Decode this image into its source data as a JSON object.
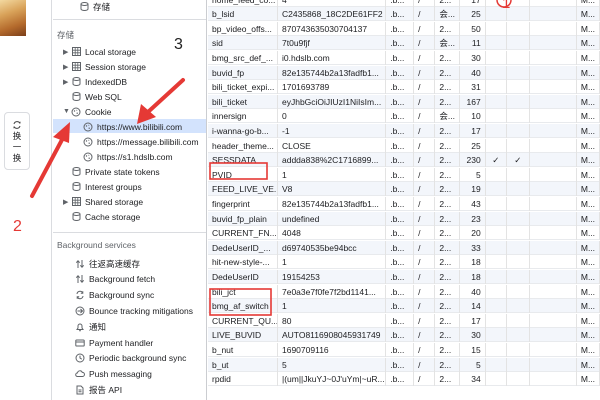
{
  "left_strip": {
    "swap_label_1": "换",
    "swap_label_2": "一",
    "swap_label_3": "换"
  },
  "sidebar": {
    "top_label": "存储",
    "storage_title": "存储",
    "storage_items": [
      {
        "label": "Local storage",
        "icon": "grid-icon"
      },
      {
        "label": "Session storage",
        "icon": "grid-icon"
      },
      {
        "label": "IndexedDB",
        "icon": "database-icon"
      },
      {
        "label": "Web SQL",
        "icon": "database-icon"
      },
      {
        "label": "Cookie",
        "icon": "cookie-icon"
      }
    ],
    "cookie_sites": [
      "https://www.bilibili.com",
      "https://message.bilibili.com",
      "https://s1.hdslb.com"
    ],
    "more_items": [
      {
        "label": "Private state tokens",
        "icon": "database-icon"
      },
      {
        "label": "Interest groups",
        "icon": "database-icon"
      },
      {
        "label": "Shared storage",
        "icon": "grid-icon"
      },
      {
        "label": "Cache storage",
        "icon": "database-icon"
      }
    ],
    "background_title": "Background services",
    "background_items": [
      {
        "label": "往返高速缓存",
        "icon": "cache-arrows-icon"
      },
      {
        "label": "Background fetch",
        "icon": "arrows-icon"
      },
      {
        "label": "Background sync",
        "icon": "sync-icon"
      },
      {
        "label": "Bounce tracking mitigations",
        "icon": "bounce-icon"
      },
      {
        "label": "通知",
        "icon": "bell-icon"
      },
      {
        "label": "Payment handler",
        "icon": "card-icon"
      },
      {
        "label": "Periodic background sync",
        "icon": "clock-icon"
      },
      {
        "label": "Push messaging",
        "icon": "cloud-icon"
      },
      {
        "label": "报告 API",
        "icon": "doc-icon"
      }
    ]
  },
  "cookies": [
    {
      "name": "home_feed_co...",
      "value": "4",
      "domain": ".b...",
      "path": "/",
      "expires": "2...",
      "size": "17",
      "http": "",
      "secure": "",
      "samesite": "",
      "priority": "M..."
    },
    {
      "name": "b_lsid",
      "value": "C2435868_18C2DE61FF2",
      "domain": ".b...",
      "path": "/",
      "expires": "会...",
      "size": "25",
      "http": "",
      "secure": "",
      "samesite": "",
      "priority": "M..."
    },
    {
      "name": "bp_video_offs...",
      "value": "870743635030704137",
      "domain": ".b...",
      "path": "/",
      "expires": "2...",
      "size": "50",
      "http": "",
      "secure": "",
      "samesite": "",
      "priority": "M..."
    },
    {
      "name": "sid",
      "value": "7t0u9fjf",
      "domain": ".b...",
      "path": "/",
      "expires": "会...",
      "size": "11",
      "http": "",
      "secure": "",
      "samesite": "",
      "priority": "M..."
    },
    {
      "name": "bmg_src_def_...",
      "value": "i0.hdslb.com",
      "domain": ".b...",
      "path": "/",
      "expires": "2...",
      "size": "30",
      "http": "",
      "secure": "",
      "samesite": "",
      "priority": "M..."
    },
    {
      "name": "buvid_fp",
      "value": "82e135744b2a13fadfb1...",
      "domain": ".b...",
      "path": "/",
      "expires": "2...",
      "size": "40",
      "http": "",
      "secure": "",
      "samesite": "",
      "priority": "M..."
    },
    {
      "name": "bili_ticket_expi...",
      "value": "1701693789",
      "domain": ".b...",
      "path": "/",
      "expires": "2...",
      "size": "31",
      "http": "",
      "secure": "",
      "samesite": "",
      "priority": "M..."
    },
    {
      "name": "bili_ticket",
      "value": "eyJhbGciOiJIUzI1NiIsIm...",
      "domain": ".b...",
      "path": "/",
      "expires": "2...",
      "size": "167",
      "http": "",
      "secure": "",
      "samesite": "",
      "priority": "M..."
    },
    {
      "name": "innersign",
      "value": "0",
      "domain": ".b...",
      "path": "/",
      "expires": "会...",
      "size": "10",
      "http": "",
      "secure": "",
      "samesite": "",
      "priority": "M..."
    },
    {
      "name": "i-wanna-go-b...",
      "value": "-1",
      "domain": ".b...",
      "path": "/",
      "expires": "2...",
      "size": "17",
      "http": "",
      "secure": "",
      "samesite": "",
      "priority": "M..."
    },
    {
      "name": "header_theme...",
      "value": "CLOSE",
      "domain": ".b...",
      "path": "/",
      "expires": "2...",
      "size": "25",
      "http": "",
      "secure": "",
      "samesite": "",
      "priority": "M..."
    },
    {
      "name": "SESSDATA",
      "value": "addda838%2C1716899...",
      "domain": ".b...",
      "path": "/",
      "expires": "2...",
      "size": "230",
      "http": "✓",
      "secure": "✓",
      "samesite": "",
      "priority": "M..."
    },
    {
      "name": "PVID",
      "value": "1",
      "domain": ".b...",
      "path": "/",
      "expires": "2...",
      "size": "5",
      "http": "",
      "secure": "",
      "samesite": "",
      "priority": "M..."
    },
    {
      "name": "FEED_LIVE_VE...",
      "value": "V8",
      "domain": ".b...",
      "path": "/",
      "expires": "2...",
      "size": "19",
      "http": "",
      "secure": "",
      "samesite": "",
      "priority": "M..."
    },
    {
      "name": "fingerprint",
      "value": "82e135744b2a13fadfb1...",
      "domain": ".b...",
      "path": "/",
      "expires": "2...",
      "size": "43",
      "http": "",
      "secure": "",
      "samesite": "",
      "priority": "M..."
    },
    {
      "name": "buvid_fp_plain",
      "value": "undefined",
      "domain": ".b...",
      "path": "/",
      "expires": "2...",
      "size": "23",
      "http": "",
      "secure": "",
      "samesite": "",
      "priority": "M..."
    },
    {
      "name": "CURRENT_FN...",
      "value": "4048",
      "domain": ".b...",
      "path": "/",
      "expires": "2...",
      "size": "20",
      "http": "",
      "secure": "",
      "samesite": "",
      "priority": "M..."
    },
    {
      "name": "DedeUserID_...",
      "value": "d69740535be94bcc",
      "domain": ".b...",
      "path": "/",
      "expires": "2...",
      "size": "33",
      "http": "",
      "secure": "",
      "samesite": "",
      "priority": "M..."
    },
    {
      "name": "hit-new-style-...",
      "value": "1",
      "domain": ".b...",
      "path": "/",
      "expires": "2...",
      "size": "18",
      "http": "",
      "secure": "",
      "samesite": "",
      "priority": "M..."
    },
    {
      "name": "DedeUserID",
      "value": "19154253",
      "domain": ".b...",
      "path": "/",
      "expires": "2...",
      "size": "18",
      "http": "",
      "secure": "",
      "samesite": "",
      "priority": "M..."
    },
    {
      "name": "bili_jct",
      "value": "7e0a3e7f0fe7f2bd1141...",
      "domain": ".b...",
      "path": "/",
      "expires": "2...",
      "size": "40",
      "http": "",
      "secure": "",
      "samesite": "",
      "priority": "M..."
    },
    {
      "name": "bmg_af_switch",
      "value": "1",
      "domain": ".b...",
      "path": "/",
      "expires": "2...",
      "size": "14",
      "http": "",
      "secure": "",
      "samesite": "",
      "priority": "M..."
    },
    {
      "name": "CURRENT_QU...",
      "value": "80",
      "domain": ".b...",
      "path": "/",
      "expires": "2...",
      "size": "17",
      "http": "",
      "secure": "",
      "samesite": "",
      "priority": "M..."
    },
    {
      "name": "LIVE_BUVID",
      "value": "AUTO8116908045931749",
      "domain": ".b...",
      "path": "/",
      "expires": "2...",
      "size": "30",
      "http": "",
      "secure": "",
      "samesite": "",
      "priority": "M..."
    },
    {
      "name": "b_nut",
      "value": "1690709116",
      "domain": ".b...",
      "path": "/",
      "expires": "2...",
      "size": "15",
      "http": "",
      "secure": "",
      "samesite": "",
      "priority": "M..."
    },
    {
      "name": "b_ut",
      "value": "5",
      "domain": ".b...",
      "path": "/",
      "expires": "2...",
      "size": "5",
      "http": "",
      "secure": "",
      "samesite": "",
      "priority": "M..."
    },
    {
      "name": "rpdid",
      "value": "|(um||JkuYJ~0J'uYm|~uR...",
      "domain": ".b...",
      "path": "/",
      "expires": "2...",
      "size": "34",
      "http": "",
      "secure": "",
      "samesite": "",
      "priority": "M..."
    }
  ],
  "annotations": {
    "numbers": [
      "1",
      "2",
      "3"
    ],
    "color": "#e53935"
  },
  "colors": {
    "selection": "#d3e3fd",
    "row_alt": "#f3f6fb",
    "highlight_box": "#e53935"
  }
}
